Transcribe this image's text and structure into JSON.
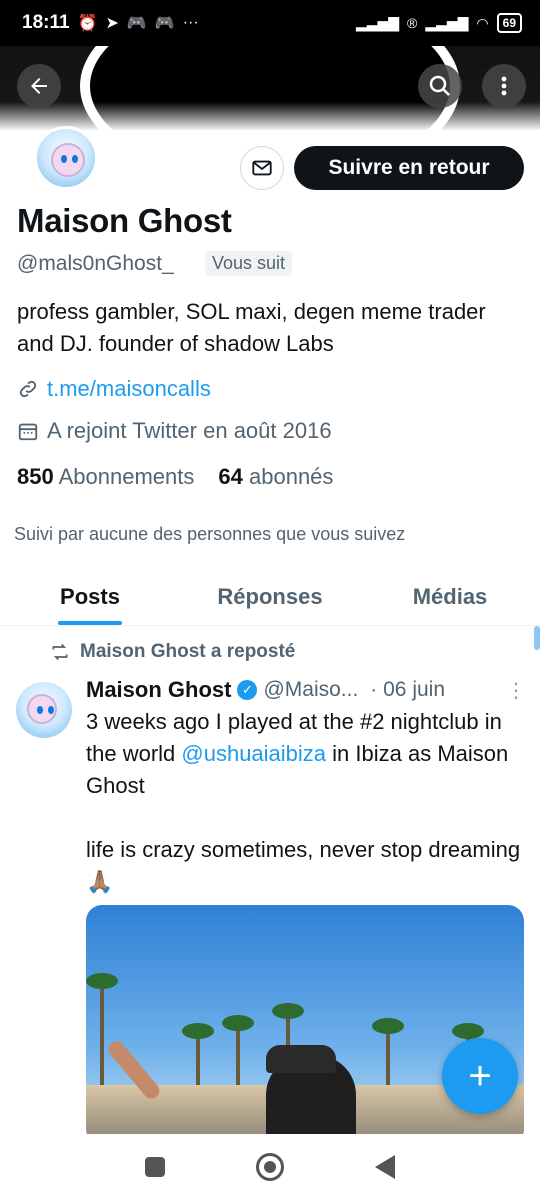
{
  "status_bar": {
    "time": "18:11",
    "battery": "69",
    "ellipsis": "···"
  },
  "banner": {
    "back_icon": "arrow-left-icon",
    "search_icon": "search-icon",
    "more_icon": "more-vertical-icon"
  },
  "profile": {
    "message_icon": "mail-icon",
    "follow_button": "Suivre en retour",
    "name": "Maison Ghost",
    "handle": "@mals0nGhost_",
    "follows_you": "Vous suit",
    "bio": "profess gambler, SOL maxi, degen meme trader and DJ. founder of shadow Labs",
    "link": "t.me/maisoncalls",
    "joined": "A rejoint Twitter en août 2016",
    "following_count": "850",
    "following_label": "Abonnements",
    "followers_count": "64",
    "followers_label": "abonnés",
    "followed_by": "Suivi par aucune des personnes que vous suivez"
  },
  "tabs": [
    {
      "label": "Posts",
      "active": true
    },
    {
      "label": "Réponses",
      "active": false
    },
    {
      "label": "Médias",
      "active": false
    }
  ],
  "post": {
    "repost_label": "Maison Ghost a reposté",
    "author_name": "Maison Ghost",
    "author_handle": "@Maiso...",
    "date": "· 06 juin",
    "text_part1": "3 weeks ago I played at the #2 nightclub in the world ",
    "mention": "@ushuaiaibiza",
    "text_part2": " in Ibiza as Maison Ghost\n\nlife is crazy sometimes, never stop dreaming 🙏🏽"
  },
  "fab": {
    "label": "+"
  },
  "colors": {
    "accent": "#1d9bf0",
    "text": "#0f1419",
    "muted": "#536471"
  }
}
